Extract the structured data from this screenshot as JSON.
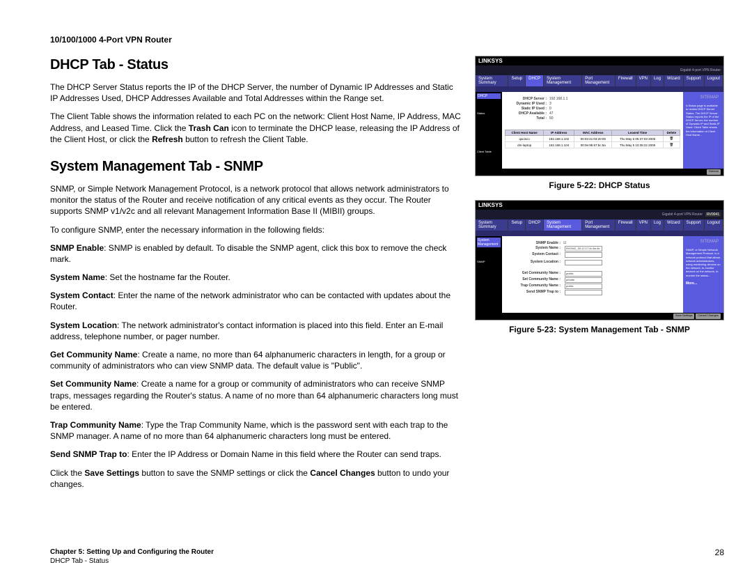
{
  "product": "10/100/1000 4-Port VPN Router",
  "h1_a": "DHCP Tab - Status",
  "p1": "The DHCP Server Status reports the IP of the DHCP Server, the number of Dynamic IP Addresses and Static IP Addresses Used, DHCP Addresses Available and Total Addresses within the Range set.",
  "p2a": "The Client Table shows the information related to each PC on the network: Client Host Name, IP Address, MAC Address, and Leased Time. Click the ",
  "p2b": "Trash Can",
  "p2c": " icon to terminate the DHCP lease, releasing the IP Address of the Client Host, or click the ",
  "p2d": "Refresh",
  "p2e": " button to refresh the Client Table.",
  "h1_b": "System Management Tab - SNMP",
  "p3": "SNMP, or Simple Network Management Protocol, is a network protocol that allows network administrators to monitor the status of the Router and receive notification of any critical events as they occur. The Router supports SNMP v1/v2c and all relevant Management Information Base II (MIBII) groups.",
  "p4": "To configure SNMP, enter the necessary information in the following fields:",
  "li1a": "SNMP Enable",
  "li1b": ": SNMP is enabled by default. To disable the SNMP agent, click this box to remove the check mark.",
  "li2a": "System Name",
  "li2b": ": Set the hostname far the Router.",
  "li3a": "System Contact",
  "li3b": ": Enter the name of the network administrator who can be contacted with updates about the Router.",
  "li4a": "System Location",
  "li4b": ": The network administrator's contact information is placed into this field. Enter an E-mail address, telephone number, or pager number.",
  "li5a": "Get Community Name",
  "li5b": ": Create a name, no more than 64 alphanumeric characters in length, for a group or community of administrators who can view SNMP data. The default value is \"Public\".",
  "li6a": "Set Community Name",
  "li6b": ": Create a name for a group or community of administrators who can receive SNMP traps, messages regarding the Router's status. A name of no more than 64 alphanumeric characters long must be entered.",
  "li7a": "Trap Community Name",
  "li7b": ": Type the Trap Community Name, which is the password sent with each trap to the SNMP manager. A name of no more than 64 alphanumeric characters long must be entered.",
  "li8a": "Send SNMP Trap to",
  "li8b": ": Enter the IP Address or Domain Name in this field where the Router can send traps.",
  "p9a": "Click the ",
  "p9b": "Save Settings",
  "p9c": " button to save the SNMP settings or click the ",
  "p9d": "Cancel Changes",
  "p9e": " button to undo your changes.",
  "fig22_caption": "Figure 5-22: DHCP Status",
  "fig23_caption": "Figure 5-23: System Management Tab - SNMP",
  "footer_chapter": "Chapter 5: Setting Up and Configuring the Router",
  "footer_sub": "DHCP Tab - Status",
  "page_num": "28",
  "fig22": {
    "brand": "LINKSYS",
    "model_label": "Gigabit 4-port VPN Router",
    "side1": "DHCP",
    "side2": "Status",
    "side3": "Client Table",
    "sitemap": "SITEMAP",
    "tabs": [
      "System Summary",
      "Setup",
      "DHCP",
      "System Management",
      "Port Management",
      "Firewall",
      "VPN",
      "Log",
      "Wizard",
      "Support",
      "Logout"
    ],
    "stats": [
      {
        "label": "DHCP Server :",
        "val": "192.168.1.1"
      },
      {
        "label": "Dynamic IP Used :",
        "val": "3"
      },
      {
        "label": "Static IP Used :",
        "val": "0"
      },
      {
        "label": "DHCP Available :",
        "val": "47"
      },
      {
        "label": "Total :",
        "val": "50"
      }
    ],
    "table_headers": [
      "Client Host Name",
      "IP Address",
      "MAC Address",
      "Leased Time",
      "Delete"
    ],
    "table_rows": [
      [
        "qacisco",
        "192.168.1.102",
        "00:03:41:03:20:09",
        "Thu May 6 05:37:03 2005",
        "🗑"
      ],
      [
        "dm-laptop",
        "192.168.1.104",
        "00:0e:9b:67:bc:5a",
        "Thu May 5 10:35:22 2005",
        "🗑"
      ]
    ],
    "refresh": "Refresh"
  },
  "fig23": {
    "brand": "LINKSYS",
    "model_label": "Gigabit 4-port VPN Router",
    "model_num": "RV0041",
    "side1": "System Management",
    "side2": "SNMP",
    "sitemap": "SITEMAP",
    "tabs": [
      "System Summary",
      "Setup",
      "DHCP",
      "System Management",
      "Port Management",
      "Firewall",
      "VPN",
      "Log",
      "Wizard",
      "Support",
      "Logout"
    ],
    "fields": [
      {
        "label": "SNMP Enable :",
        "val": "☑"
      },
      {
        "label": "System Name :",
        "val": "RV0042_00:12:17:4c:6e:4b"
      },
      {
        "label": "System Contact :",
        "val": ""
      },
      {
        "label": "System Location :",
        "val": ""
      },
      {
        "label": "Get Community Name :",
        "val": "public"
      },
      {
        "label": "Set Community Name :",
        "val": "private"
      },
      {
        "label": "Trap Community Name :",
        "val": "public"
      },
      {
        "label": "Send SNMP Trap to :",
        "val": ""
      }
    ],
    "save": "Save Settings",
    "cancel": "Cancel Changes"
  }
}
